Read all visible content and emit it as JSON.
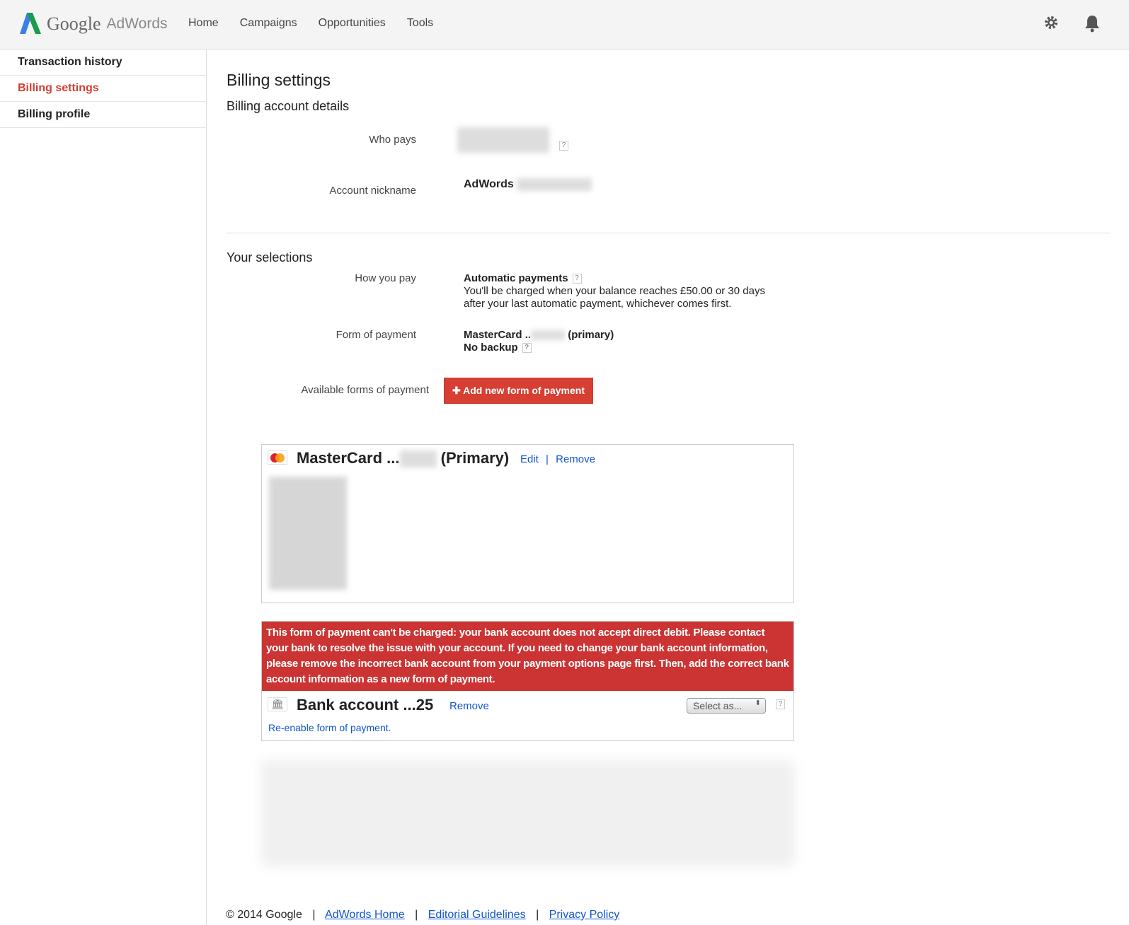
{
  "header": {
    "logo_google": "Google",
    "logo_adwords": "AdWords",
    "nav": [
      "Home",
      "Campaigns",
      "Opportunities",
      "Tools"
    ]
  },
  "sidebar": {
    "items": [
      {
        "label": "Transaction history"
      },
      {
        "label": "Billing settings"
      },
      {
        "label": "Billing profile"
      }
    ]
  },
  "page": {
    "title": "Billing settings",
    "section1": "Billing account details",
    "who_pays_label": "Who pays",
    "nickname_label": "Account nickname",
    "nickname_value": "AdWords",
    "section2": "Your selections",
    "how_label": "How you pay",
    "how_value": "Automatic payments",
    "how_desc1": "You'll be charged when your balance reaches £50.00 or 30 days",
    "how_desc2": "after your last automatic payment, whichever comes first.",
    "form_label": "Form of payment",
    "form_value_prefix": "MasterCard ..",
    "form_value_suffix": "(primary)",
    "backup": "No backup",
    "available_label": "Available forms of payment",
    "add_button": "Add new form of payment"
  },
  "cards": {
    "mastercard": {
      "title_prefix": "MasterCard ...",
      "title_suffix": "(Primary)",
      "edit": "Edit",
      "sep": "|",
      "remove": "Remove"
    },
    "bank": {
      "error": "This form of payment can't be charged: your bank account does not accept direct debit. Please contact your bank to resolve the issue with your account. If you need to change your bank account information, please remove the incorrect bank account from your payment options page first. Then, add the correct bank account information as a new form of payment.",
      "title": "Bank account ...25",
      "remove": "Remove",
      "select": "Select as...",
      "reenable": "Re-enable form of payment."
    }
  },
  "footer": {
    "copyright": "© 2014 Google",
    "links": [
      "AdWords Home",
      "Editorial Guidelines",
      "Privacy Policy"
    ],
    "sep": "|"
  }
}
